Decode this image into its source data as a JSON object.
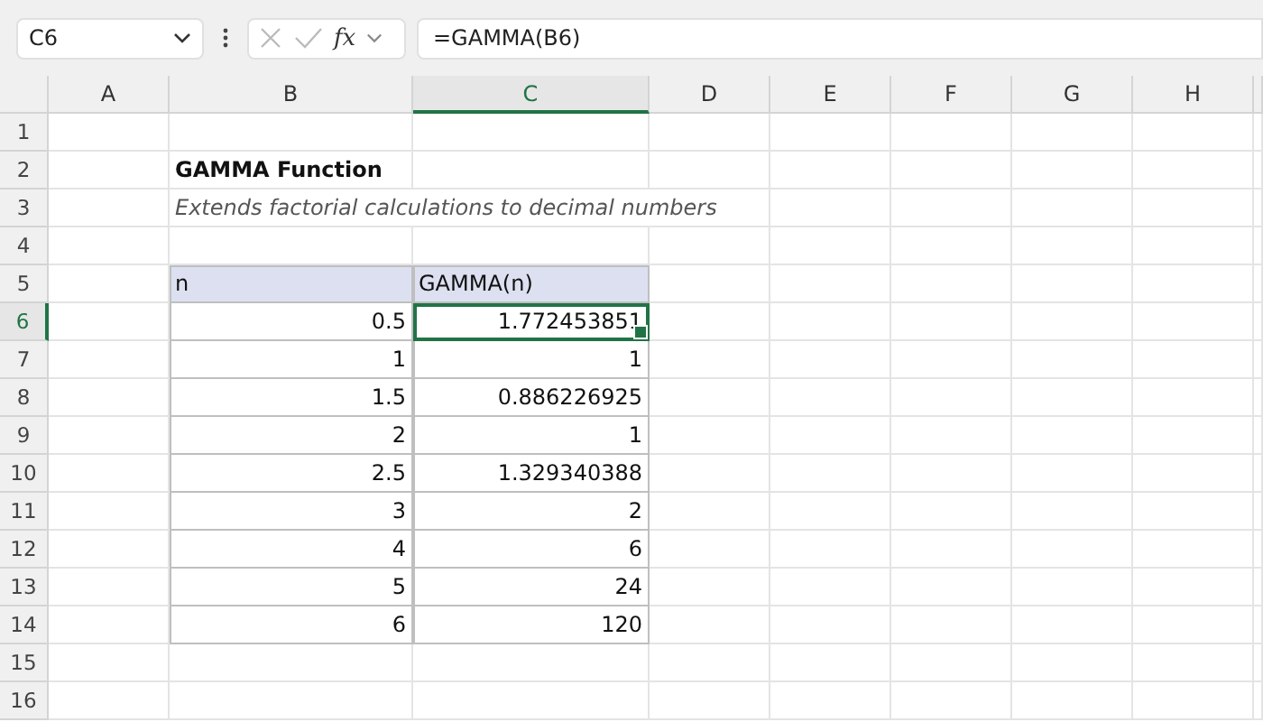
{
  "name_box": "C6",
  "formula": "=GAMMA(B6)",
  "fx_label": "fx",
  "columns": [
    {
      "label": "A",
      "selected": false
    },
    {
      "label": "B",
      "selected": false
    },
    {
      "label": "C",
      "selected": true
    },
    {
      "label": "D",
      "selected": false
    },
    {
      "label": "E",
      "selected": false
    },
    {
      "label": "F",
      "selected": false
    },
    {
      "label": "G",
      "selected": false
    },
    {
      "label": "H",
      "selected": false
    }
  ],
  "rows": [
    {
      "number": "1",
      "selected": false,
      "kind": "blank"
    },
    {
      "number": "2",
      "selected": false,
      "kind": "title",
      "text": "GAMMA Function"
    },
    {
      "number": "3",
      "selected": false,
      "kind": "subtitle",
      "text": "Extends factorial calculations to decimal numbers"
    },
    {
      "number": "4",
      "selected": false,
      "kind": "blank"
    },
    {
      "number": "5",
      "selected": false,
      "kind": "header",
      "cells": [
        {
          "text": "n"
        },
        {
          "text": "GAMMA(n)"
        }
      ]
    },
    {
      "number": "6",
      "selected": true,
      "kind": "data",
      "cells": [
        {
          "text": "0.5",
          "selected": false
        },
        {
          "text": "1.772453851",
          "selected": true
        }
      ]
    },
    {
      "number": "7",
      "selected": false,
      "kind": "data",
      "cells": [
        {
          "text": "1",
          "selected": false
        },
        {
          "text": "1",
          "selected": false
        }
      ]
    },
    {
      "number": "8",
      "selected": false,
      "kind": "data",
      "cells": [
        {
          "text": "1.5",
          "selected": false
        },
        {
          "text": "0.886226925",
          "selected": false
        }
      ]
    },
    {
      "number": "9",
      "selected": false,
      "kind": "data",
      "cells": [
        {
          "text": "2",
          "selected": false
        },
        {
          "text": "1",
          "selected": false
        }
      ]
    },
    {
      "number": "10",
      "selected": false,
      "kind": "data",
      "cells": [
        {
          "text": "2.5",
          "selected": false
        },
        {
          "text": "1.329340388",
          "selected": false
        }
      ]
    },
    {
      "number": "11",
      "selected": false,
      "kind": "data",
      "cells": [
        {
          "text": "3",
          "selected": false
        },
        {
          "text": "2",
          "selected": false
        }
      ]
    },
    {
      "number": "12",
      "selected": false,
      "kind": "data",
      "cells": [
        {
          "text": "4",
          "selected": false
        },
        {
          "text": "6",
          "selected": false
        }
      ]
    },
    {
      "number": "13",
      "selected": false,
      "kind": "data",
      "cells": [
        {
          "text": "5",
          "selected": false
        },
        {
          "text": "24",
          "selected": false
        }
      ]
    },
    {
      "number": "14",
      "selected": false,
      "kind": "data",
      "cells": [
        {
          "text": "6",
          "selected": false
        },
        {
          "text": "120",
          "selected": false
        }
      ]
    },
    {
      "number": "15",
      "selected": false,
      "kind": "blank"
    },
    {
      "number": "16",
      "selected": false,
      "kind": "blank"
    }
  ]
}
